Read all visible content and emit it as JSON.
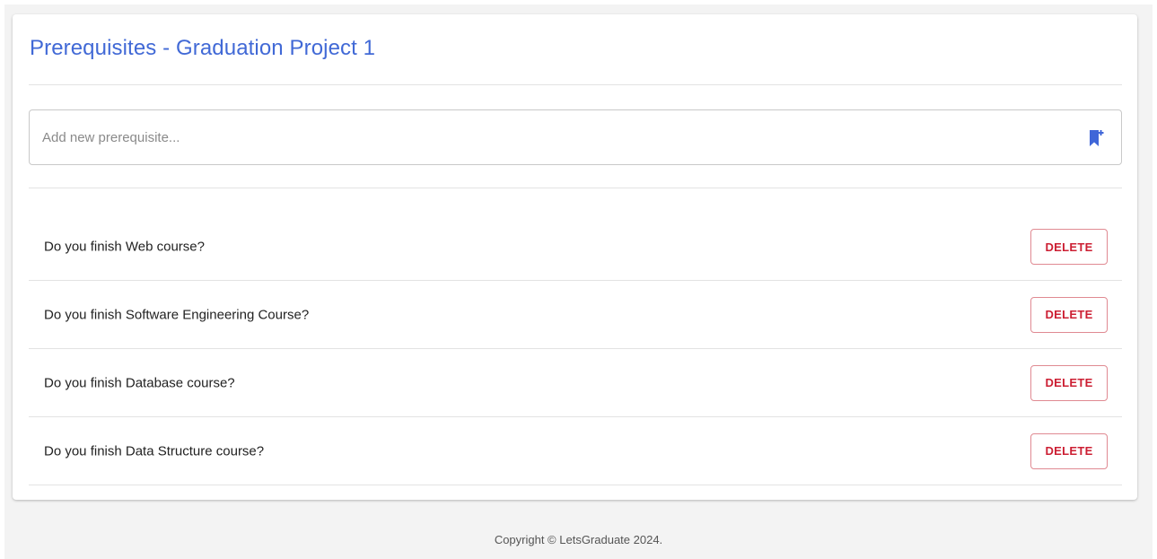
{
  "card": {
    "title": "Prerequisites - Graduation Project 1"
  },
  "new_prerequisite": {
    "placeholder": "Add new prerequisite...",
    "value": "",
    "add_icon": "bookmark-plus-icon"
  },
  "prerequisites": [
    {
      "text": "Do you finish Web course?",
      "delete_label": "DELETE"
    },
    {
      "text": "Do you finish Software Engineering Course?",
      "delete_label": "DELETE"
    },
    {
      "text": "Do you finish Database course?",
      "delete_label": "DELETE"
    },
    {
      "text": "Do you finish Data Structure course?",
      "delete_label": "DELETE"
    }
  ],
  "footer": {
    "copyright": "Copyright © LetsGraduate 2024."
  },
  "colors": {
    "title": "#4169d6",
    "accent_icon": "#3f66d8",
    "delete_text": "#cc1f33",
    "delete_border": "#e08a92",
    "page_background": "#f3f3f3"
  }
}
